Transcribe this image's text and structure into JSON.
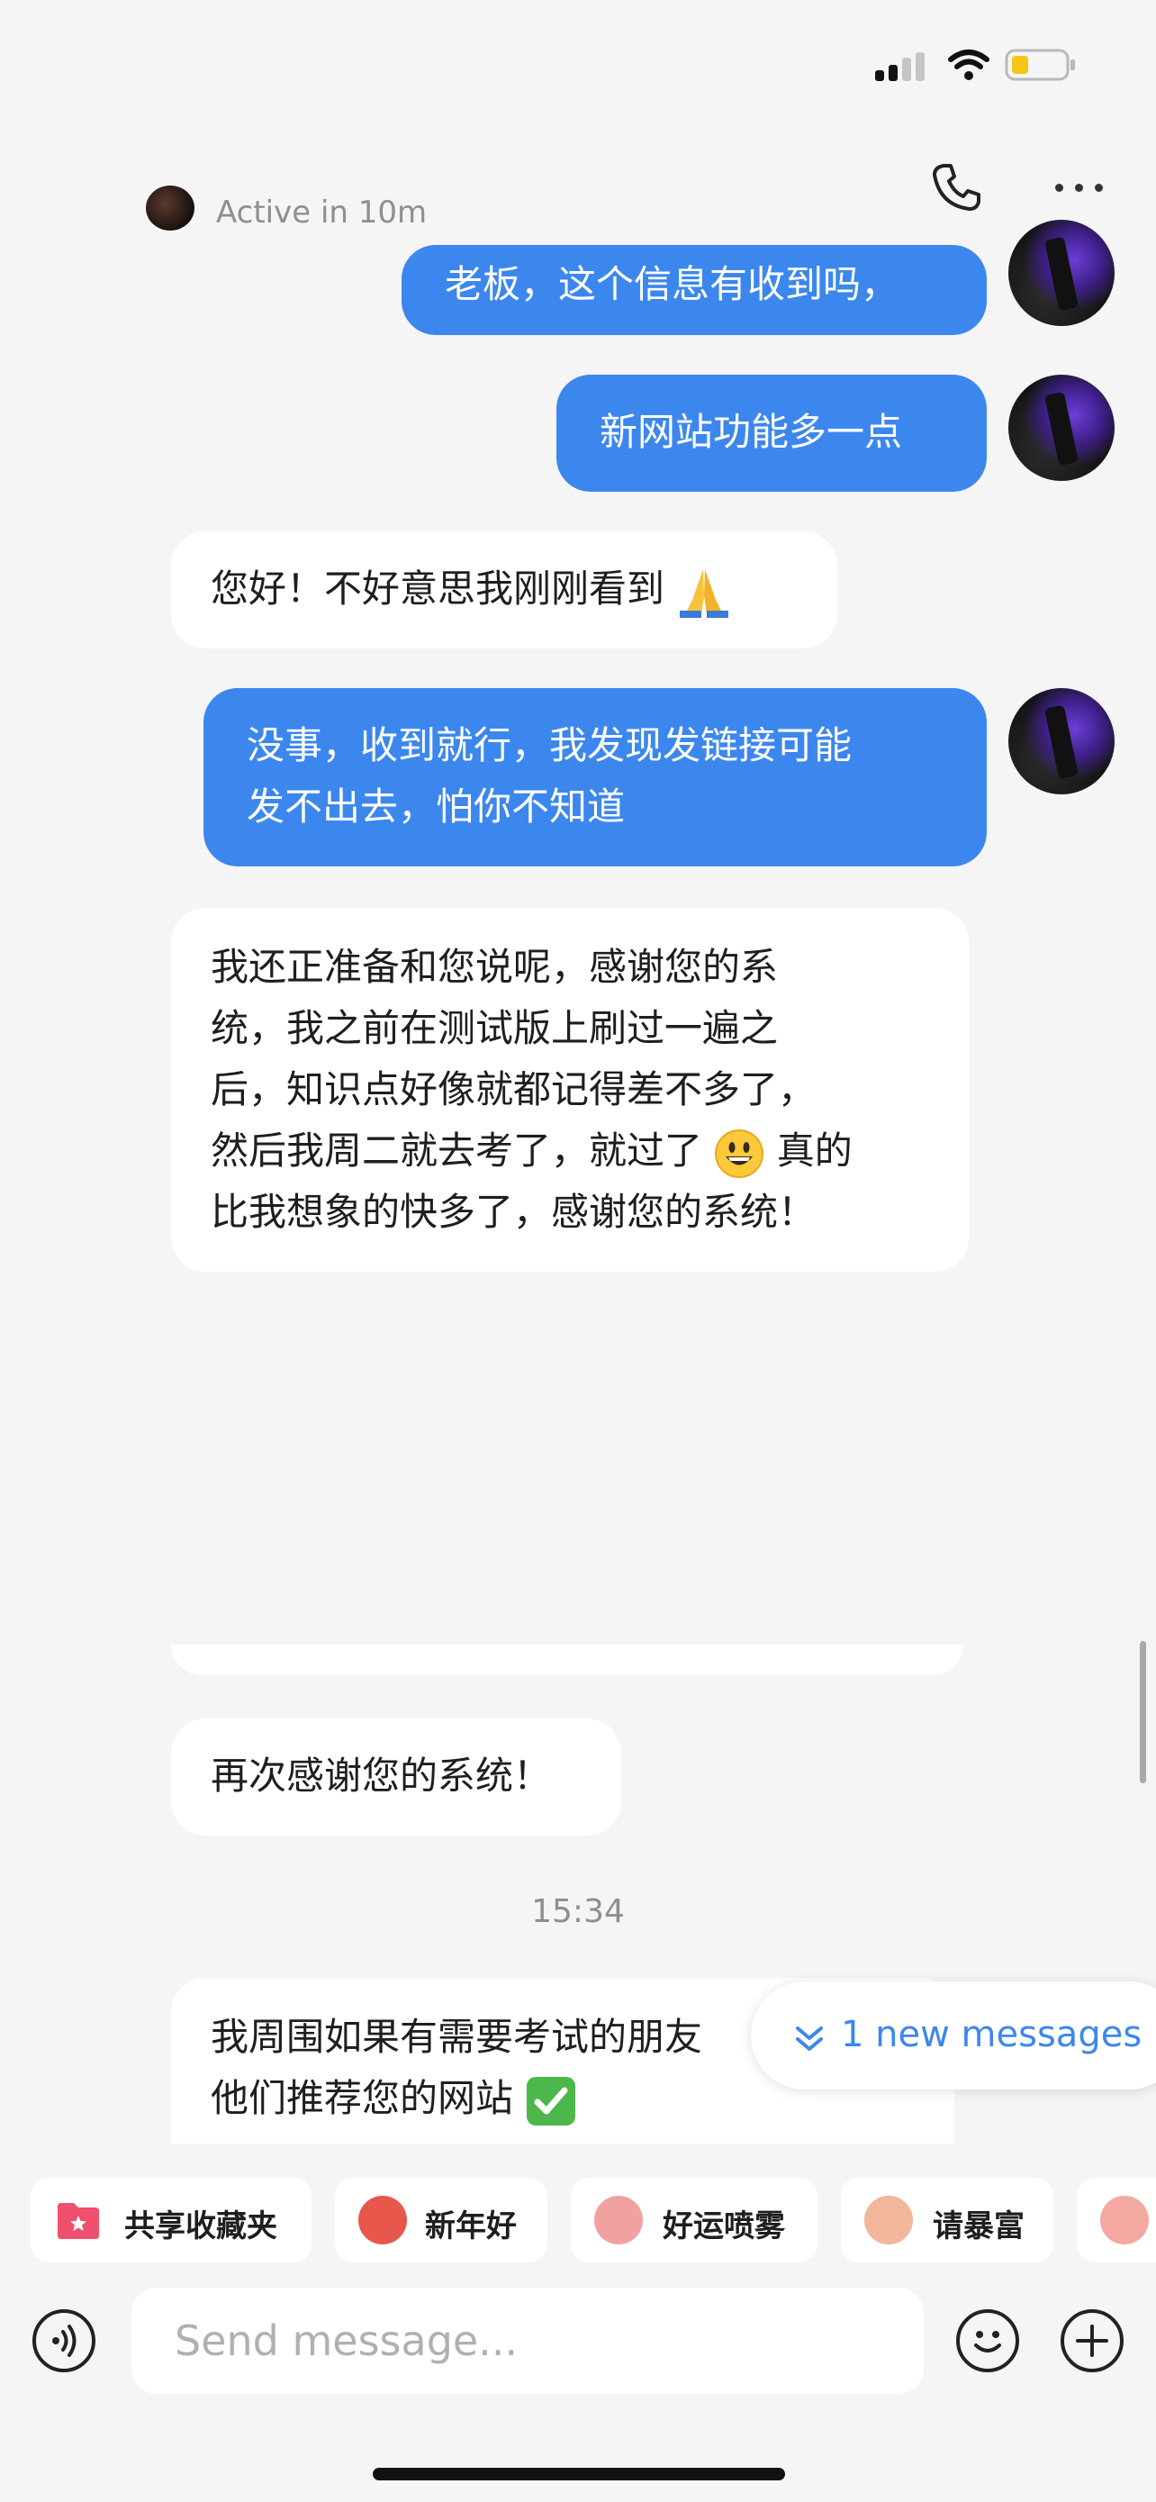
{
  "header": {
    "status_text": "Active in 10m"
  },
  "messages": [
    {
      "side": "out",
      "text": "老板，这个信息有收到吗，"
    },
    {
      "side": "out",
      "text": "新网站功能多一点"
    },
    {
      "side": "in",
      "text": "您好！不好意思我刚刚看到",
      "emoji": "folded-hands"
    },
    {
      "side": "out",
      "lines": [
        "没事，收到就行，我发现发链接可能",
        "发不出去，怕你不知道"
      ]
    },
    {
      "side": "in",
      "lines": [
        "我还正准备和您说呢，感谢您的系",
        "统，我之前在测试版上刷过一遍之",
        "后，知识点好像就都记得差不多了，",
        "然后我周二就去考了，就过了",
        "比我想象的快多了，感谢您的系统！"
      ],
      "line4_after": "真的",
      "emoji": "grinning-face"
    },
    {
      "side": "in",
      "text": "再次感谢您的系统！"
    },
    {
      "side": "in",
      "lines": [
        "我周围如果有需要考试的朋友",
        "他们推荐您的网站"
      ],
      "emoji": "check-mark"
    }
  ],
  "time_separator": "15:34",
  "new_messages_pill": "1 new messages",
  "quick_actions": [
    {
      "label": "共享收藏夹",
      "icon": "folder-star-icon",
      "color": "#f0506e"
    },
    {
      "label": "新年好",
      "icon": "new-year-sticker-icon",
      "color": "#e8574b"
    },
    {
      "label": "好运喷雾",
      "icon": "good-luck-sticker-icon",
      "color": "#f2a1a1"
    },
    {
      "label": "请暴富",
      "icon": "get-rich-sticker-icon",
      "color": "#f2b69a"
    }
  ],
  "composer": {
    "placeholder": "Send message..."
  }
}
